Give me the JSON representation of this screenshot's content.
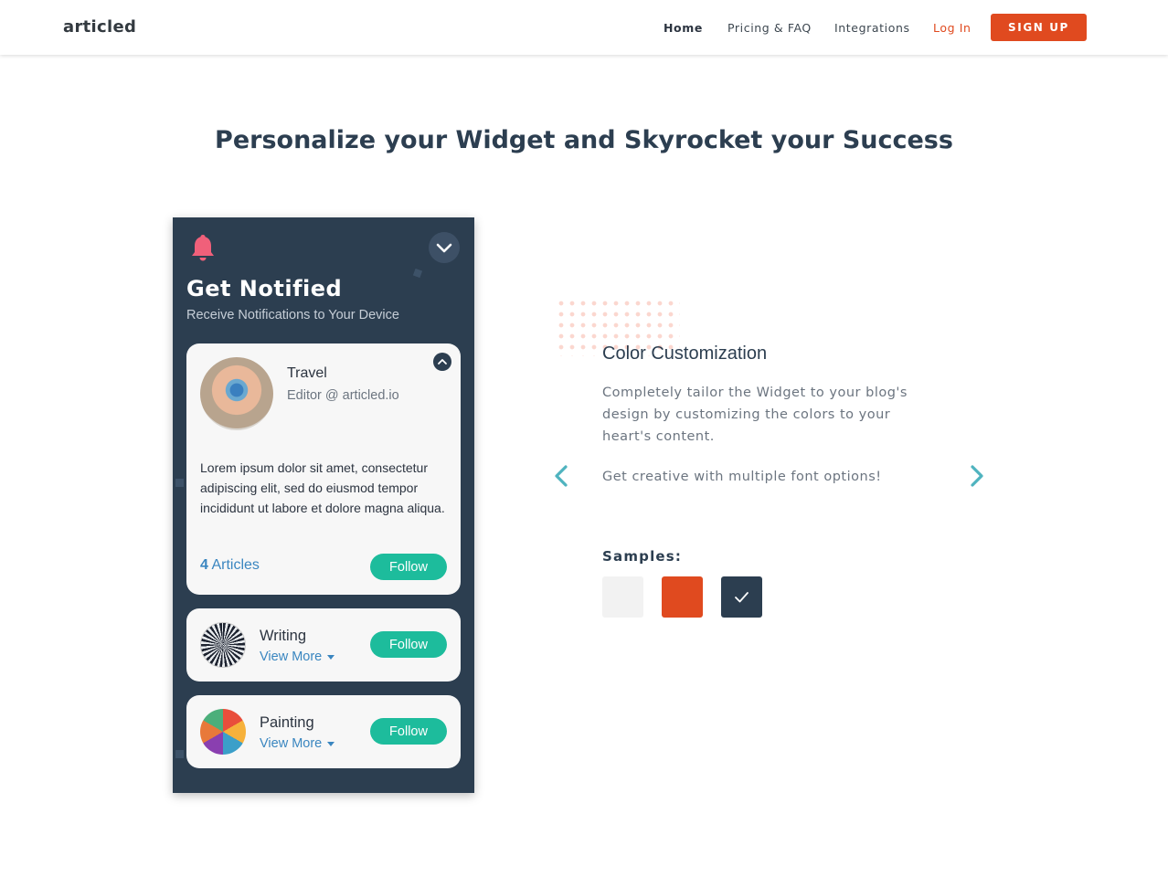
{
  "header": {
    "logo": "articled",
    "nav": {
      "home": "Home",
      "pricing": "Pricing & FAQ",
      "integrations": "Integrations",
      "login": "Log In",
      "signup": "SIGN UP"
    }
  },
  "page_title": "Personalize your Widget and Skyrocket your Success",
  "widget": {
    "title": "Get Notified",
    "subtitle": "Receive Notifications to Your Device",
    "main_card": {
      "name": "Travel",
      "role": "Editor @ articled.io",
      "description": "Lorem ipsum dolor sit amet, consectetur adipiscing elit, sed do eiusmod tempor incididunt ut labore et dolore magna aliqua.",
      "articles_count": "4",
      "articles_label": "Articles",
      "follow_label": "Follow"
    },
    "cards": [
      {
        "name": "Writing",
        "view_more": "View More",
        "follow_label": "Follow"
      },
      {
        "name": "Painting",
        "view_more": "View More",
        "follow_label": "Follow"
      }
    ]
  },
  "feature": {
    "title": "Color Customization",
    "description": "Completely tailor the Widget to your blog's design by customizing the colors to your heart's content.",
    "description2": "Get creative with multiple font options!",
    "samples_label": "Samples:"
  },
  "colors": {
    "accent": "#e04a1f",
    "dark": "#2c3e50",
    "follow": "#1dbc9c",
    "link": "#3a86c0",
    "bell": "#f0607a",
    "swatches": [
      "#f2f2f2",
      "#e04a1f",
      "#2c3e50"
    ]
  },
  "icons": [
    "bell-icon",
    "chevron-down-icon",
    "chevron-up-icon",
    "caret-down-icon",
    "chevron-left-icon",
    "chevron-right-icon",
    "check-icon"
  ]
}
